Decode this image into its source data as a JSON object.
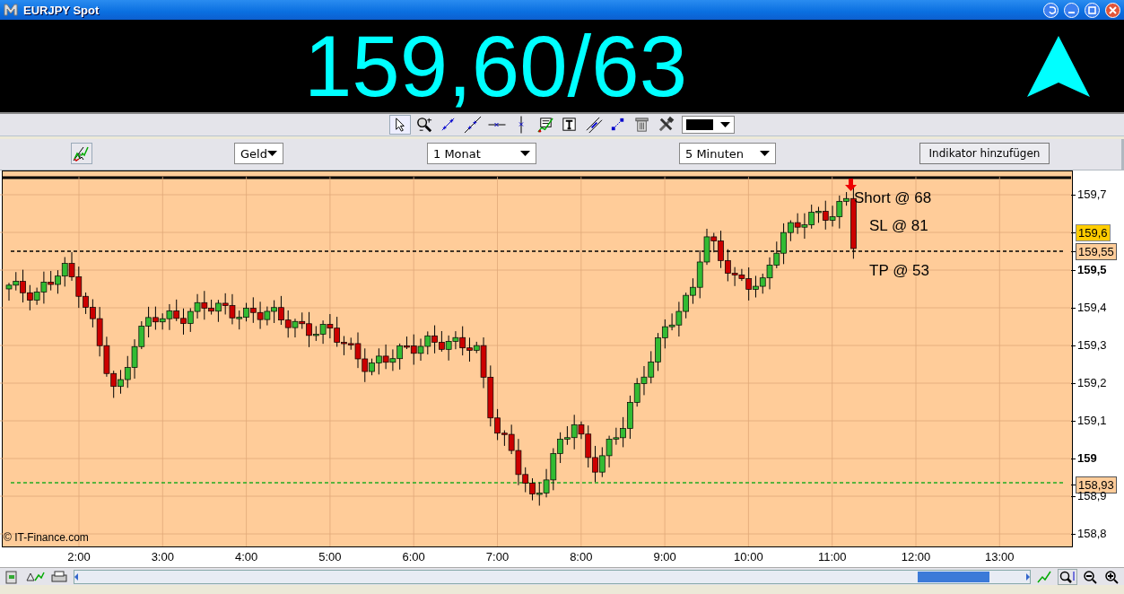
{
  "window": {
    "title": "EURJPY Spot"
  },
  "banner": {
    "price": "159,60/63"
  },
  "toolbar": {
    "tools": [
      {
        "kind": "pointer",
        "selected": true
      },
      {
        "kind": "zoom",
        "selected": false
      },
      {
        "kind": "segment",
        "selected": false
      },
      {
        "kind": "trendline",
        "selected": false
      },
      {
        "kind": "hline",
        "selected": false
      },
      {
        "kind": "vline",
        "selected": false
      },
      {
        "kind": "chart",
        "selected": false
      },
      {
        "kind": "text",
        "selected": false
      },
      {
        "kind": "channel",
        "selected": false
      },
      {
        "kind": "move",
        "selected": false
      },
      {
        "kind": "trash",
        "selected": false
      },
      {
        "kind": "tools",
        "selected": false
      }
    ],
    "color_swatch": {
      "color": "#000000"
    }
  },
  "controls": {
    "price_type": "Geld",
    "range": "1 Monat",
    "interval": "5 Minuten",
    "indicator_button": "Indikator hinzufügen"
  },
  "chart": {
    "annotations": [
      "Short @ 68",
      "SL @ 81",
      "TP @ 53"
    ],
    "y_labels": [
      {
        "label": "159,7",
        "kind": "plain"
      },
      {
        "label": "159,6",
        "kind": "current"
      },
      {
        "label": "159,55",
        "kind": "line"
      },
      {
        "label": "159,5",
        "kind": "bold"
      },
      {
        "label": "159,4",
        "kind": "plain"
      },
      {
        "label": "159,3",
        "kind": "plain"
      },
      {
        "label": "159,2",
        "kind": "plain"
      },
      {
        "label": "159,1",
        "kind": "plain"
      },
      {
        "label": "159",
        "kind": "bold"
      },
      {
        "label": "158,93",
        "kind": "line"
      },
      {
        "label": "158,9",
        "kind": "plain"
      },
      {
        "label": "158,8",
        "kind": "plain"
      }
    ],
    "x_labels": [
      "2:00",
      "3:00",
      "4:00",
      "5:00",
      "6:00",
      "7:00",
      "8:00",
      "9:00",
      "10:00",
      "11:00",
      "12:00",
      "13:00"
    ],
    "copyright": "© IT-Finance.com"
  }
}
